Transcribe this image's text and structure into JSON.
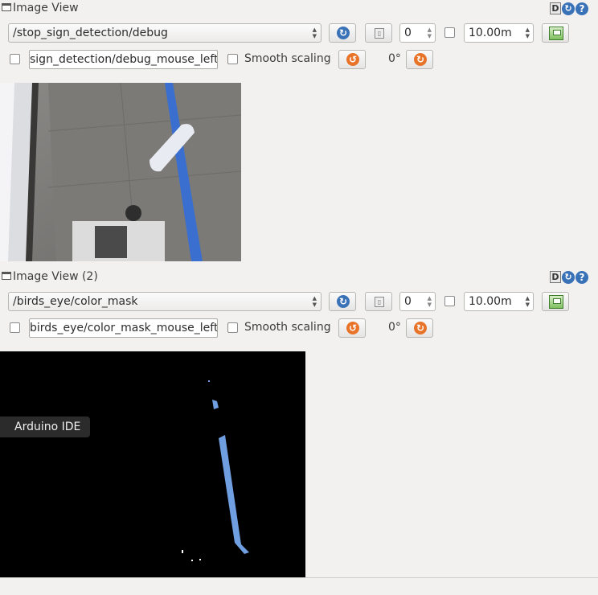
{
  "panels": [
    {
      "title": "Image View",
      "topic": "/stop_sign_detection/debug",
      "spin_value": "0",
      "timeout": "10.00m",
      "mouse_topic": "sign_detection/debug_mouse_left",
      "smooth_label": "Smooth scaling",
      "rotation": "0°"
    },
    {
      "title": "Image View (2)",
      "topic": "/birds_eye/color_mask",
      "spin_value": "0",
      "timeout": "10.00m",
      "mouse_topic": "birds_eye/color_mask_mouse_left",
      "smooth_label": "Smooth scaling",
      "rotation": "0°"
    }
  ],
  "titlebar_icons": {
    "dock": "D"
  },
  "tooltip": "Arduino IDE",
  "icons": [
    "window-icon",
    "dock-icon",
    "reload-icon",
    "help-icon",
    "refresh-icon",
    "pause-icon",
    "save-icon",
    "rotate-left-icon",
    "rotate-right-icon"
  ],
  "colors": {
    "mask_line": "#6f9fe0",
    "camera_tape": "#3a6fd0",
    "accent_orange": "#e8742a",
    "accent_blue": "#3a72b8"
  }
}
